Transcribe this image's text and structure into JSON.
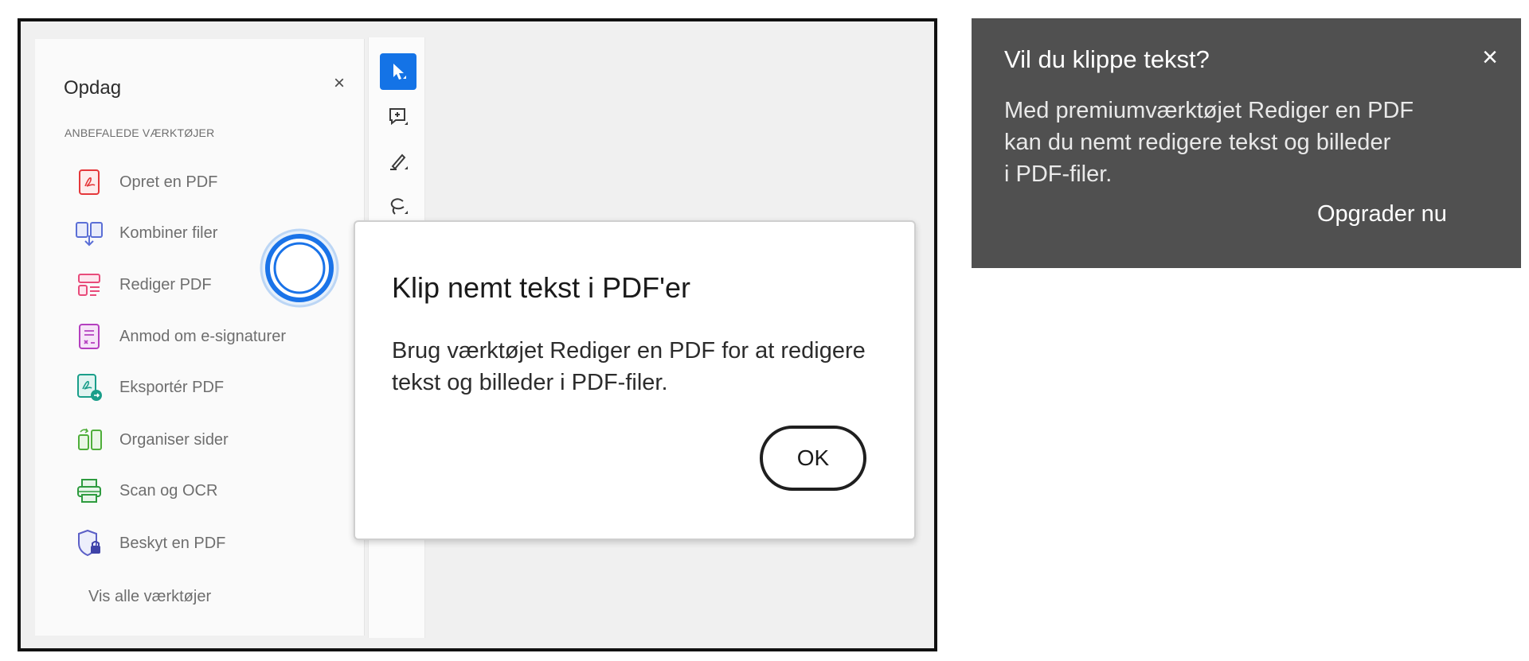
{
  "panel": {
    "title": "Opdag",
    "close_icon": "close-icon",
    "section_label": "ANBEFALEDE VÆRKTØJER",
    "tools": [
      {
        "label": "Opret en PDF",
        "icon": "create-pdf-icon",
        "color": "#e5383b"
      },
      {
        "label": "Kombiner filer",
        "icon": "combine-files-icon",
        "color": "#5b6fd6"
      },
      {
        "label": "Rediger PDF",
        "icon": "edit-pdf-icon",
        "color": "#e84b7a"
      },
      {
        "label": "Anmod om e-signaturer",
        "icon": "request-signatures-icon",
        "color": "#b43fbf"
      },
      {
        "label": "Eksportér PDF",
        "icon": "export-pdf-icon",
        "color": "#1a9e8a"
      },
      {
        "label": "Organiser sider",
        "icon": "organize-pages-icon",
        "color": "#4fae3a"
      },
      {
        "label": "Scan og OCR",
        "icon": "scan-ocr-icon",
        "color": "#2e9b3f"
      },
      {
        "label": "Beskyt en PDF",
        "icon": "protect-pdf-icon",
        "color": "#5b5fc7"
      }
    ],
    "view_all": "Vis alle værktøjer"
  },
  "toolbar": {
    "tools": [
      "select-cursor-icon",
      "add-comment-icon",
      "highlight-pen-icon",
      "lasso-draw-icon"
    ],
    "active_color": "#1473e6"
  },
  "modal": {
    "title": "Klip nemt tekst i PDF'er",
    "body": "Brug værktøjet Rediger en PDF for at redigere tekst og billeder i PDF-filer.",
    "ok_label": "OK"
  },
  "tooltip": {
    "title": "Vil du klippe tekst?",
    "body_lines": [
      "Med premiumværktøjet Rediger en PDF",
      "kan du nemt redigere tekst og billeder",
      "i PDF-filer."
    ],
    "link_label": "Opgrader nu",
    "background": "#505050"
  }
}
